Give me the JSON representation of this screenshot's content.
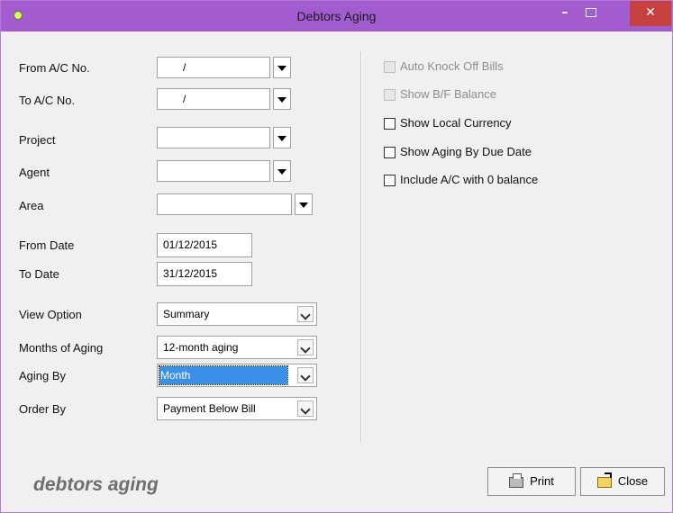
{
  "window": {
    "title": "Debtors Aging",
    "minimize": "–",
    "close": "✕"
  },
  "form": {
    "from_ac": {
      "label": "From A/C No.",
      "value": "/"
    },
    "to_ac": {
      "label": "To A/C No.",
      "value": "/"
    },
    "project": {
      "label": "Project",
      "value": ""
    },
    "agent": {
      "label": "Agent",
      "value": ""
    },
    "area": {
      "label": "Area",
      "value": ""
    },
    "from_date": {
      "label": "From Date",
      "value": "01/12/2015"
    },
    "to_date": {
      "label": "To Date",
      "value": "31/12/2015"
    },
    "view_option": {
      "label": "View Option",
      "value": "Summary"
    },
    "months_of_aging": {
      "label": "Months of Aging",
      "value": "12-month aging"
    },
    "aging_by": {
      "label": "Aging By",
      "value": "Month"
    },
    "order_by": {
      "label": "Order By",
      "value": "Payment Below Bill"
    }
  },
  "options": {
    "auto_knock_off": {
      "label": "Auto Knock Off Bills",
      "checked": false,
      "enabled": false
    },
    "show_bf_balance": {
      "label": "Show B/F Balance",
      "checked": false,
      "enabled": false
    },
    "show_local_currency": {
      "label": "Show Local Currency",
      "checked": false,
      "enabled": true
    },
    "show_aging_due_date": {
      "label": "Show Aging By Due Date",
      "checked": false,
      "enabled": true
    },
    "include_zero_balance": {
      "label": "Include A/C with 0 balance",
      "checked": false,
      "enabled": true
    }
  },
  "footer": {
    "caption": "debtors aging",
    "print_label": "Print",
    "close_label": "Close"
  },
  "colors": {
    "titlebar": "#a35bd0",
    "close_button": "#c6403e",
    "selection": "#3a90e6"
  }
}
